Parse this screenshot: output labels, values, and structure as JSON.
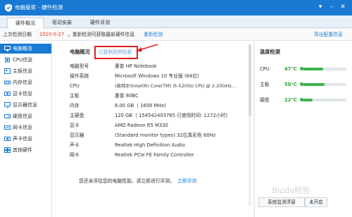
{
  "window": {
    "title": "电脑管家 - 硬件检测",
    "accent": "#1a79d2"
  },
  "tabs": [
    {
      "label": "硬件概况"
    },
    {
      "label": "驱动安装"
    },
    {
      "label": "硬件评测"
    }
  ],
  "infobar": {
    "prefix": "上次检测日期",
    "date": "2020-5-27",
    "suffix": "，重新检测可获取最新硬件信息",
    "recheck": "重新检测",
    "export": "导出配置信息"
  },
  "sidebar": {
    "items": [
      {
        "label": "电脑概览",
        "icon": "computer-icon"
      },
      {
        "label": "CPU信息",
        "icon": "cpu-icon"
      },
      {
        "label": "主板信息",
        "icon": "motherboard-icon"
      },
      {
        "label": "内存信息",
        "icon": "memory-icon"
      },
      {
        "label": "显卡信息",
        "icon": "gpu-icon"
      },
      {
        "label": "显示器信息",
        "icon": "monitor-icon"
      },
      {
        "label": "硬盘信息",
        "icon": "disk-icon"
      },
      {
        "label": "网卡信息",
        "icon": "network-card-icon"
      },
      {
        "label": "声卡信息",
        "icon": "sound-card-icon"
      },
      {
        "label": "其他硬件",
        "icon": "other-hardware-icon"
      }
    ]
  },
  "overview": {
    "heading": "电脑概况",
    "copy_link": "已复制到剪贴板",
    "rows": [
      {
        "label": "电脑型号",
        "value": "惠普 HP Notebook"
      },
      {
        "label": "操作系统",
        "value": "Microsoft Windows 10 专业版 (64位)"
      },
      {
        "label": "CPU",
        "value": "(英特尔)Intel(R) Core(TM) i5-5200U CPU @ 2.20GHz..."
      },
      {
        "label": "主板",
        "value": "惠普 80BC"
      },
      {
        "label": "内存",
        "value": "8.00 GB（ 1600 MHz)"
      },
      {
        "label": "主硬盘",
        "value": "120 GB（ 154542403765 已使用时间: 1272小时)"
      },
      {
        "label": "显卡",
        "value": "AMD Radeon R5 M330"
      },
      {
        "label": "显示器",
        "value": "(Standard monitor types) 32位真彩色 60Hz"
      },
      {
        "label": "声卡",
        "value": "Realtek High Definition Audio"
      },
      {
        "label": "网卡",
        "value": "Realtek PCIe FE Family Controller"
      }
    ],
    "footer_text": "您还未评估您的电脑性能，请立即进行评测。",
    "footer_link": "立即评测"
  },
  "temperature": {
    "heading": "温度检测",
    "items": [
      {
        "label": "CPU",
        "value": "47℃",
        "level": 0.47
      },
      {
        "label": "主板",
        "value": "50℃",
        "level": 0.5
      },
      {
        "label": "硬盘",
        "value": "22℃",
        "level": 0.22
      }
    ],
    "mode_button": "系统监测浮窗",
    "toggle_button": "未开启"
  },
  "watermark": "Baidu经验"
}
